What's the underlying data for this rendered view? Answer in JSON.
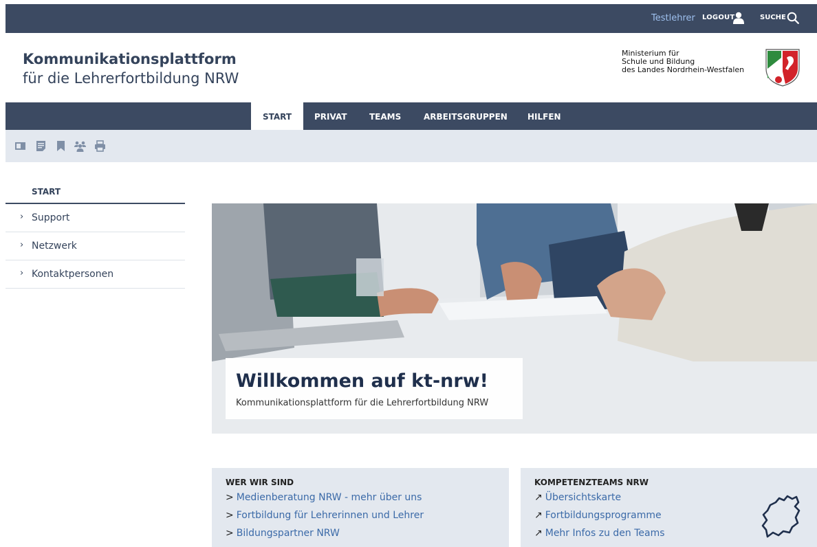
{
  "header": {
    "user": "Testlehrer",
    "logout_label": "LOGOUT",
    "search_label": "SUCHE",
    "title": "Kommunikationsplattform",
    "subtitle": "für die Lehrerfortbildung NRW",
    "ministry_line1": "Ministerium für",
    "ministry_line2": "Schule und Bildung",
    "ministry_line3": "des Landes Nordrhein-Westfalen"
  },
  "nav": {
    "items": [
      {
        "label": "START",
        "active": true
      },
      {
        "label": "PRIVAT",
        "active": false
      },
      {
        "label": "TEAMS",
        "active": false
      },
      {
        "label": "ARBEITSGRUPPEN",
        "active": false
      },
      {
        "label": "HILFEN",
        "active": false
      }
    ]
  },
  "toolbar": {
    "icons": [
      "card-view-icon",
      "notes-icon",
      "bookmark-icon",
      "team-icon",
      "print-icon"
    ]
  },
  "sidebar": {
    "heading": "START",
    "items": [
      {
        "label": "Support"
      },
      {
        "label": "Netzwerk"
      },
      {
        "label": "Kontaktpersonen"
      }
    ]
  },
  "hero": {
    "title": "Willkommen auf kt-nrw!",
    "subtitle": "Kommunikationsplattform für die Lehrerfortbildung NRW"
  },
  "boxes": [
    {
      "title": "WER WIR SIND",
      "arrow": ">",
      "links": [
        "Medienberatung NRW - mehr über uns",
        "Fortbildung für Lehrerinnen und Lehrer",
        "Bildungspartner NRW"
      ]
    },
    {
      "title": "KOMPETENZTEAMS NRW",
      "arrow": "↗",
      "links": [
        "Übersichtskarte",
        "Fortbildungsprogramme",
        "Mehr Infos zu den Teams"
      ]
    }
  ],
  "colors": {
    "nav_bg": "#3c4a62",
    "toolbar_bg": "#e3e8ef",
    "link": "#3b6aa8",
    "user_link": "#9ec0ee"
  }
}
